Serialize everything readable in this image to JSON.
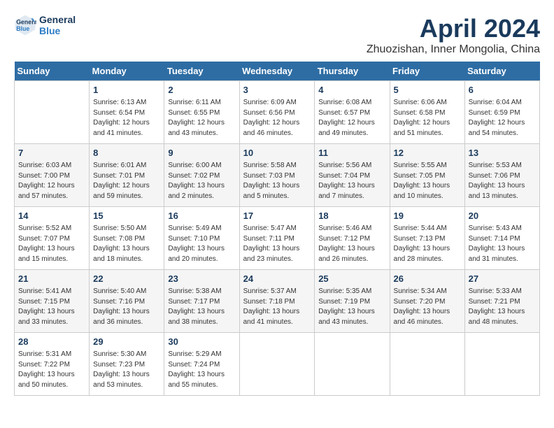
{
  "header": {
    "logo_line1": "General",
    "logo_line2": "Blue",
    "title": "April 2024",
    "subtitle": "Zhuozishan, Inner Mongolia, China"
  },
  "weekdays": [
    "Sunday",
    "Monday",
    "Tuesday",
    "Wednesday",
    "Thursday",
    "Friday",
    "Saturday"
  ],
  "weeks": [
    [
      {
        "day": "",
        "info": ""
      },
      {
        "day": "1",
        "info": "Sunrise: 6:13 AM\nSunset: 6:54 PM\nDaylight: 12 hours\nand 41 minutes."
      },
      {
        "day": "2",
        "info": "Sunrise: 6:11 AM\nSunset: 6:55 PM\nDaylight: 12 hours\nand 43 minutes."
      },
      {
        "day": "3",
        "info": "Sunrise: 6:09 AM\nSunset: 6:56 PM\nDaylight: 12 hours\nand 46 minutes."
      },
      {
        "day": "4",
        "info": "Sunrise: 6:08 AM\nSunset: 6:57 PM\nDaylight: 12 hours\nand 49 minutes."
      },
      {
        "day": "5",
        "info": "Sunrise: 6:06 AM\nSunset: 6:58 PM\nDaylight: 12 hours\nand 51 minutes."
      },
      {
        "day": "6",
        "info": "Sunrise: 6:04 AM\nSunset: 6:59 PM\nDaylight: 12 hours\nand 54 minutes."
      }
    ],
    [
      {
        "day": "7",
        "info": "Sunrise: 6:03 AM\nSunset: 7:00 PM\nDaylight: 12 hours\nand 57 minutes."
      },
      {
        "day": "8",
        "info": "Sunrise: 6:01 AM\nSunset: 7:01 PM\nDaylight: 12 hours\nand 59 minutes."
      },
      {
        "day": "9",
        "info": "Sunrise: 6:00 AM\nSunset: 7:02 PM\nDaylight: 13 hours\nand 2 minutes."
      },
      {
        "day": "10",
        "info": "Sunrise: 5:58 AM\nSunset: 7:03 PM\nDaylight: 13 hours\nand 5 minutes."
      },
      {
        "day": "11",
        "info": "Sunrise: 5:56 AM\nSunset: 7:04 PM\nDaylight: 13 hours\nand 7 minutes."
      },
      {
        "day": "12",
        "info": "Sunrise: 5:55 AM\nSunset: 7:05 PM\nDaylight: 13 hours\nand 10 minutes."
      },
      {
        "day": "13",
        "info": "Sunrise: 5:53 AM\nSunset: 7:06 PM\nDaylight: 13 hours\nand 13 minutes."
      }
    ],
    [
      {
        "day": "14",
        "info": "Sunrise: 5:52 AM\nSunset: 7:07 PM\nDaylight: 13 hours\nand 15 minutes."
      },
      {
        "day": "15",
        "info": "Sunrise: 5:50 AM\nSunset: 7:08 PM\nDaylight: 13 hours\nand 18 minutes."
      },
      {
        "day": "16",
        "info": "Sunrise: 5:49 AM\nSunset: 7:10 PM\nDaylight: 13 hours\nand 20 minutes."
      },
      {
        "day": "17",
        "info": "Sunrise: 5:47 AM\nSunset: 7:11 PM\nDaylight: 13 hours\nand 23 minutes."
      },
      {
        "day": "18",
        "info": "Sunrise: 5:46 AM\nSunset: 7:12 PM\nDaylight: 13 hours\nand 26 minutes."
      },
      {
        "day": "19",
        "info": "Sunrise: 5:44 AM\nSunset: 7:13 PM\nDaylight: 13 hours\nand 28 minutes."
      },
      {
        "day": "20",
        "info": "Sunrise: 5:43 AM\nSunset: 7:14 PM\nDaylight: 13 hours\nand 31 minutes."
      }
    ],
    [
      {
        "day": "21",
        "info": "Sunrise: 5:41 AM\nSunset: 7:15 PM\nDaylight: 13 hours\nand 33 minutes."
      },
      {
        "day": "22",
        "info": "Sunrise: 5:40 AM\nSunset: 7:16 PM\nDaylight: 13 hours\nand 36 minutes."
      },
      {
        "day": "23",
        "info": "Sunrise: 5:38 AM\nSunset: 7:17 PM\nDaylight: 13 hours\nand 38 minutes."
      },
      {
        "day": "24",
        "info": "Sunrise: 5:37 AM\nSunset: 7:18 PM\nDaylight: 13 hours\nand 41 minutes."
      },
      {
        "day": "25",
        "info": "Sunrise: 5:35 AM\nSunset: 7:19 PM\nDaylight: 13 hours\nand 43 minutes."
      },
      {
        "day": "26",
        "info": "Sunrise: 5:34 AM\nSunset: 7:20 PM\nDaylight: 13 hours\nand 46 minutes."
      },
      {
        "day": "27",
        "info": "Sunrise: 5:33 AM\nSunset: 7:21 PM\nDaylight: 13 hours\nand 48 minutes."
      }
    ],
    [
      {
        "day": "28",
        "info": "Sunrise: 5:31 AM\nSunset: 7:22 PM\nDaylight: 13 hours\nand 50 minutes."
      },
      {
        "day": "29",
        "info": "Sunrise: 5:30 AM\nSunset: 7:23 PM\nDaylight: 13 hours\nand 53 minutes."
      },
      {
        "day": "30",
        "info": "Sunrise: 5:29 AM\nSunset: 7:24 PM\nDaylight: 13 hours\nand 55 minutes."
      },
      {
        "day": "",
        "info": ""
      },
      {
        "day": "",
        "info": ""
      },
      {
        "day": "",
        "info": ""
      },
      {
        "day": "",
        "info": ""
      }
    ]
  ]
}
